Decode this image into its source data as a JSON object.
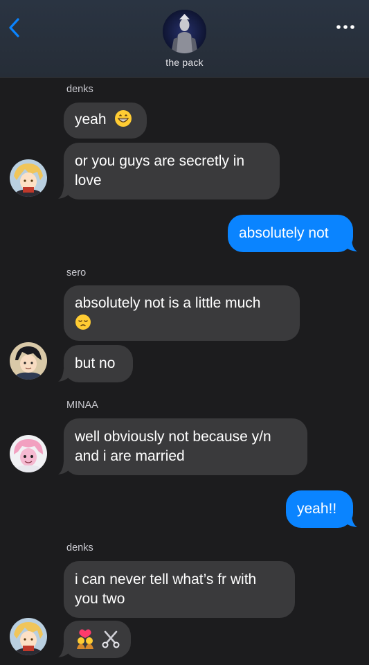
{
  "header": {
    "group_name": "the pack",
    "back_icon": "chevron-left-icon",
    "more_icon": "ellipsis-icon",
    "accent": "#0a84ff"
  },
  "messages": [
    {
      "sender": "denks"
    },
    {
      "text": "yeah",
      "emoji": "grinning-face-emoji",
      "direction": "incoming"
    },
    {
      "text_line1": "or you guys are secretly in",
      "text_line2": "love",
      "direction": "incoming"
    },
    {
      "text": "absolutely not",
      "direction": "outgoing"
    },
    {
      "sender": "sero"
    },
    {
      "text_line1": "absolutely not is a little much",
      "emoji": "pensive-face-emoji",
      "direction": "incoming"
    },
    {
      "text": "but no",
      "direction": "incoming"
    },
    {
      "sender": "MINAA"
    },
    {
      "text_line1": "well obviously not because y/n",
      "text_line2": "and i are married",
      "direction": "incoming"
    },
    {
      "text": "yeah!!",
      "direction": "outgoing"
    },
    {
      "sender": "denks"
    },
    {
      "text_line1": "i can never tell what’s fr with",
      "text_line2": "you two",
      "direction": "incoming"
    },
    {
      "emoji": "kiss-couple-and-scissors-emoji",
      "direction": "incoming"
    }
  ],
  "colors": {
    "background": "#1c1c1e",
    "incoming_bubble": "#3a3a3c",
    "outgoing_bubble": "#0a84ff"
  }
}
